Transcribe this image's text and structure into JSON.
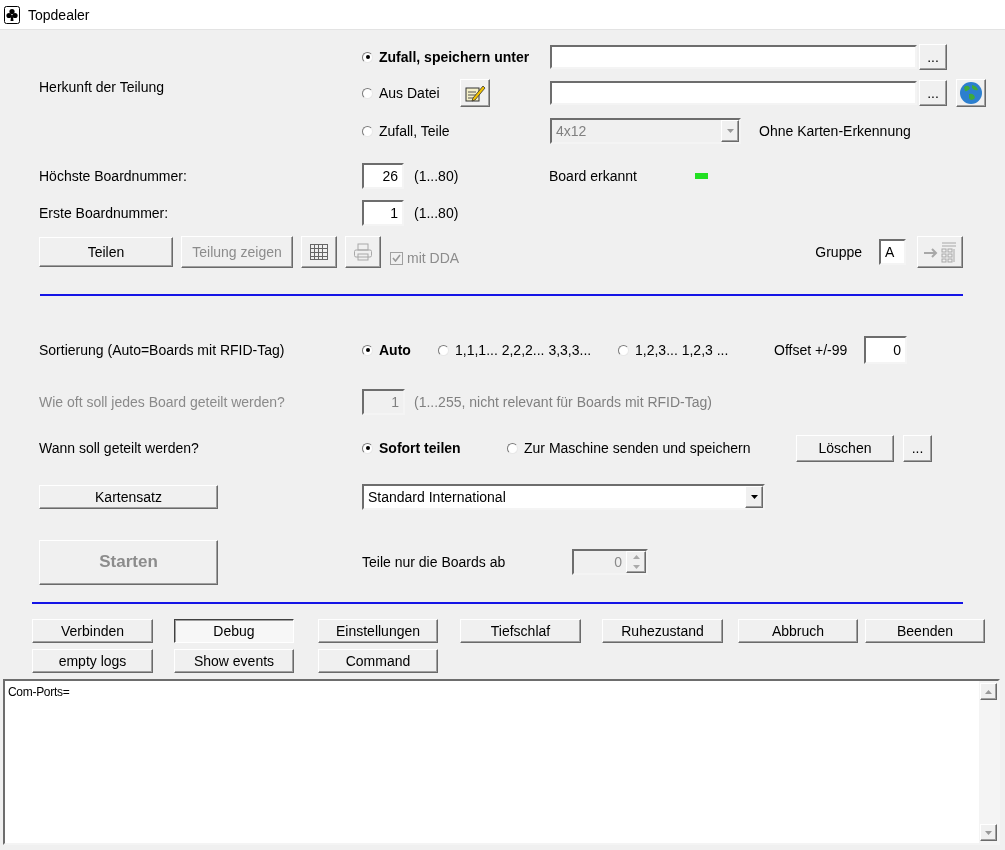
{
  "window": {
    "title": "Topdealer"
  },
  "source": {
    "label": "Herkunft der Teilung",
    "options": [
      {
        "label": "Zufall, speichern unter",
        "selected": true
      },
      {
        "label": "Aus Datei",
        "selected": false
      },
      {
        "label": "Zufall, Teile",
        "selected": false
      }
    ],
    "save_browse": "...",
    "file_browse": "...",
    "layout_select": {
      "value": "4x12",
      "disabled": true
    },
    "note": "Ohne Karten-Erkennung"
  },
  "board_numbers": [
    {
      "label": "Höchste Boardnummer:",
      "value": "26",
      "range": "(1...80)"
    },
    {
      "label": "Erste Boardnummer:",
      "value": "1",
      "range": "(1...80)"
    }
  ],
  "board_status": {
    "label": "Board erkannt",
    "on": true
  },
  "deal_actions": [
    {
      "kind": "text",
      "label": "Teilen",
      "disabled": false
    },
    {
      "kind": "text",
      "label": "Teilung zeigen",
      "disabled": true
    },
    {
      "kind": "grid",
      "disabled": false
    },
    {
      "kind": "printer",
      "disabled": true
    }
  ],
  "dda": {
    "label": "mit DDA",
    "checked": true,
    "disabled": true
  },
  "group": {
    "label": "Gruppe",
    "value": "A",
    "button_disabled": true
  },
  "sorting": {
    "label": "Sortierung (Auto=Boards mit RFID-Tag)",
    "options": [
      {
        "label": "Auto",
        "selected": true
      },
      {
        "label": "1,1,1... 2,2,2... 3,3,3...",
        "selected": false
      },
      {
        "label": "1,2,3... 1,2,3 ...",
        "selected": false
      }
    ],
    "offset_label": "Offset +/-99",
    "offset_value": "0"
  },
  "repeat": {
    "label": "Wie oft soll jedes Board geteilt werden?",
    "value": "1",
    "hint": "(1...255, nicht relevant für Boards mit RFID-Tag)",
    "disabled": true
  },
  "timing": {
    "label": "Wann soll geteilt werden?",
    "options": [
      {
        "label": "Sofort teilen",
        "selected": true
      },
      {
        "label": "Zur Maschine senden und speichern",
        "selected": false
      }
    ],
    "buttons": [
      "Löschen",
      "..."
    ]
  },
  "card_set": {
    "button": "Kartensatz",
    "value": "Standard International"
  },
  "start": {
    "button": "Starten",
    "disabled": true,
    "from_label": "Teile nur die Boards ab",
    "from_value": "0",
    "from_disabled": true
  },
  "command_rows": [
    {
      "buttons": [
        {
          "label": "Verbinden",
          "selected": false
        },
        {
          "label": "Debug",
          "selected": true
        },
        {
          "label": "Einstellungen",
          "selected": false
        },
        {
          "label": "Tiefschlaf",
          "selected": false
        },
        {
          "label": "Ruhezustand",
          "selected": false
        },
        {
          "label": "Abbruch",
          "selected": false
        },
        {
          "label": "Beenden",
          "selected": false
        }
      ]
    },
    {
      "buttons": [
        {
          "label": "empty logs",
          "selected": false
        },
        {
          "label": "Show events",
          "selected": false
        },
        {
          "label": "Command",
          "selected": false
        }
      ]
    }
  ],
  "log": {
    "lines": [
      "Com-Ports="
    ]
  }
}
